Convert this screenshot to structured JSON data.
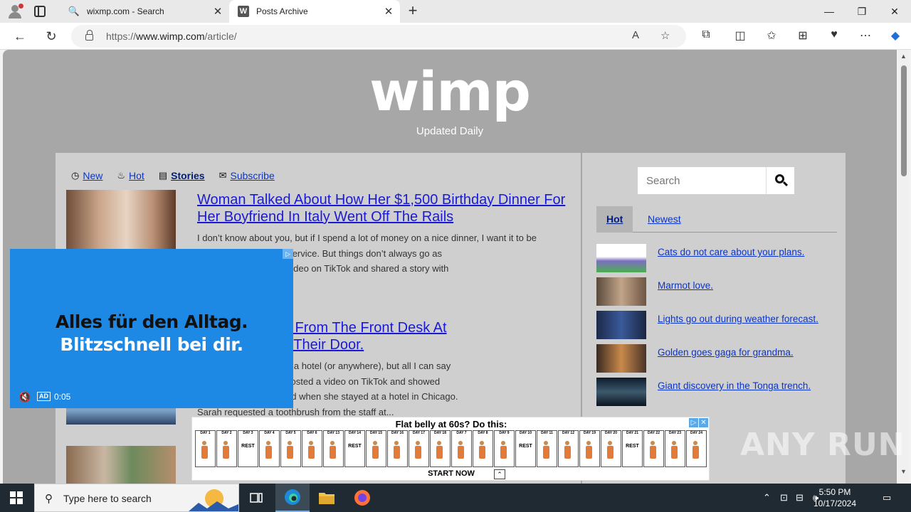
{
  "browser": {
    "tabs": [
      {
        "title": "wixmp.com - Search",
        "favicon": "search-icon"
      },
      {
        "title": "Posts Archive",
        "favicon": "w-logo-icon"
      }
    ],
    "url_prefix": "https://",
    "url_host": "www.wimp.com",
    "url_path": "/article/"
  },
  "site": {
    "logo": "wimp",
    "tagline": "Updated Daily"
  },
  "filters": [
    {
      "label": "New",
      "icon": "clock-icon"
    },
    {
      "label": "Hot",
      "icon": "flame-icon"
    },
    {
      "label": "Stories",
      "icon": "newspaper-icon"
    },
    {
      "label": "Subscribe",
      "icon": "envelope-icon"
    }
  ],
  "articles": [
    {
      "title": "Woman Talked About How Her $1,500 Birthday Dinner For Her Boyfriend In Italy Went Off The Rails",
      "excerpt_lines": [
        "I don’t know about you, but if I spend a lot of money on a nice dinner, I want it to be",
        "ans the food AND the service. But things don’t always go as",
        "amed Kacie posted a video on TikTok and shared a story with",
        "..."
      ],
      "date": "4 at 1:31 pm"
    },
    {
      "title_line1": "d A Toothbrush From The Front Desk At",
      "title_line2": "obot Arrived At Their Door.",
      "excerpt_lines": [
        "e something like this at a hotel (or anywhere), but all I can say",
        "voman named Sarah posted a video on TikTok and showed",
        "g unexpected happened when she stayed at a hotel in Chicago.",
        "Sarah requested a toothbrush from the staff at..."
      ]
    }
  ],
  "sidebar": {
    "search_placeholder": "Search",
    "tabs": [
      {
        "label": "Hot"
      },
      {
        "label": "Newest"
      }
    ],
    "items": [
      {
        "label": "Cats do not care about your plans."
      },
      {
        "label": "Marmot love."
      },
      {
        "label": "Lights go out during weather forecast."
      },
      {
        "label": "Golden goes gaga for grandma."
      },
      {
        "label": "Giant discovery in the Tonga trench."
      }
    ]
  },
  "video_ad": {
    "line1": "Alles für den Alltag.",
    "line2": "Blitzschnell bei dir.",
    "ad_tag": "AD",
    "time": "0:05"
  },
  "banner_ad": {
    "headline": "Flat belly at 60s? Do this:",
    "days": [
      "DAY 1",
      "DAY 2",
      "DAY 3",
      "DAY 4",
      "DAY 5",
      "DAY 6",
      "DAY 13",
      "DAY 14",
      "DAY 15",
      "DAY 16",
      "DAY 17",
      "DAY 18",
      "DAY 7",
      "DAY 8",
      "DAY 9",
      "DAY 10",
      "DAY 11",
      "DAY 12",
      "DAY 19",
      "DAY 20",
      "DAY 21",
      "DAY 22",
      "DAY 23",
      "DAY 24"
    ],
    "rest_label": "REST",
    "cta": "START NOW"
  },
  "watermark": "ANY RUN",
  "taskbar": {
    "search_placeholder": "Type here to search",
    "time": "5:50 PM",
    "date": "10/17/2024"
  },
  "colors": {
    "page_bg": "#a7a7a7",
    "panel_bg": "#cfcfcf",
    "link": "#1a1ad6",
    "ad_blue": "#1e88e5"
  }
}
